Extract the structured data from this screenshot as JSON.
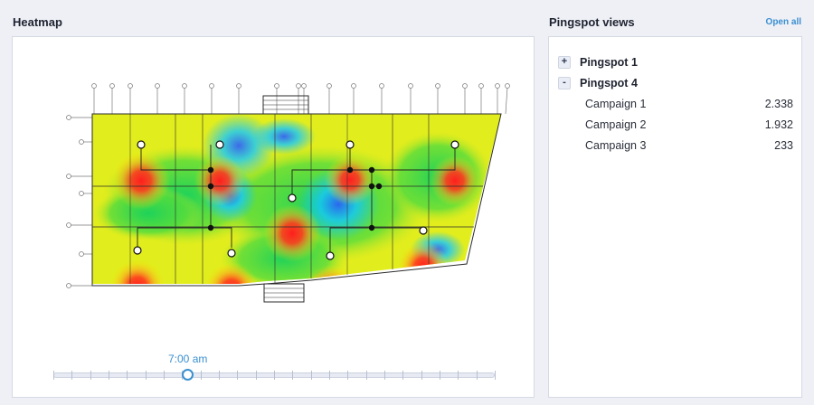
{
  "heatmap": {
    "title": "Heatmap",
    "time_label": "7:00 am",
    "slider_value_fraction": 0.305
  },
  "pingspot_views": {
    "title": "Pingspot views",
    "open_all_label": "Open all",
    "groups": [
      {
        "label": "Pingspot 1",
        "expanded": false,
        "toggle": "+"
      },
      {
        "label": "Pingspot 4",
        "expanded": true,
        "toggle": "-",
        "campaigns": [
          {
            "label": "Campaign 1",
            "value": "2.338"
          },
          {
            "label": "Campaign 2",
            "value": "1.932"
          },
          {
            "label": "Campaign 3",
            "value": "233"
          }
        ]
      }
    ]
  },
  "colors": {
    "accent": "#3a8fd0",
    "heat_high": "#ff1e1e",
    "heat_mid": "#ffe600",
    "heat_low": "#1ed25a",
    "heat_cold": "#14c8ff"
  }
}
